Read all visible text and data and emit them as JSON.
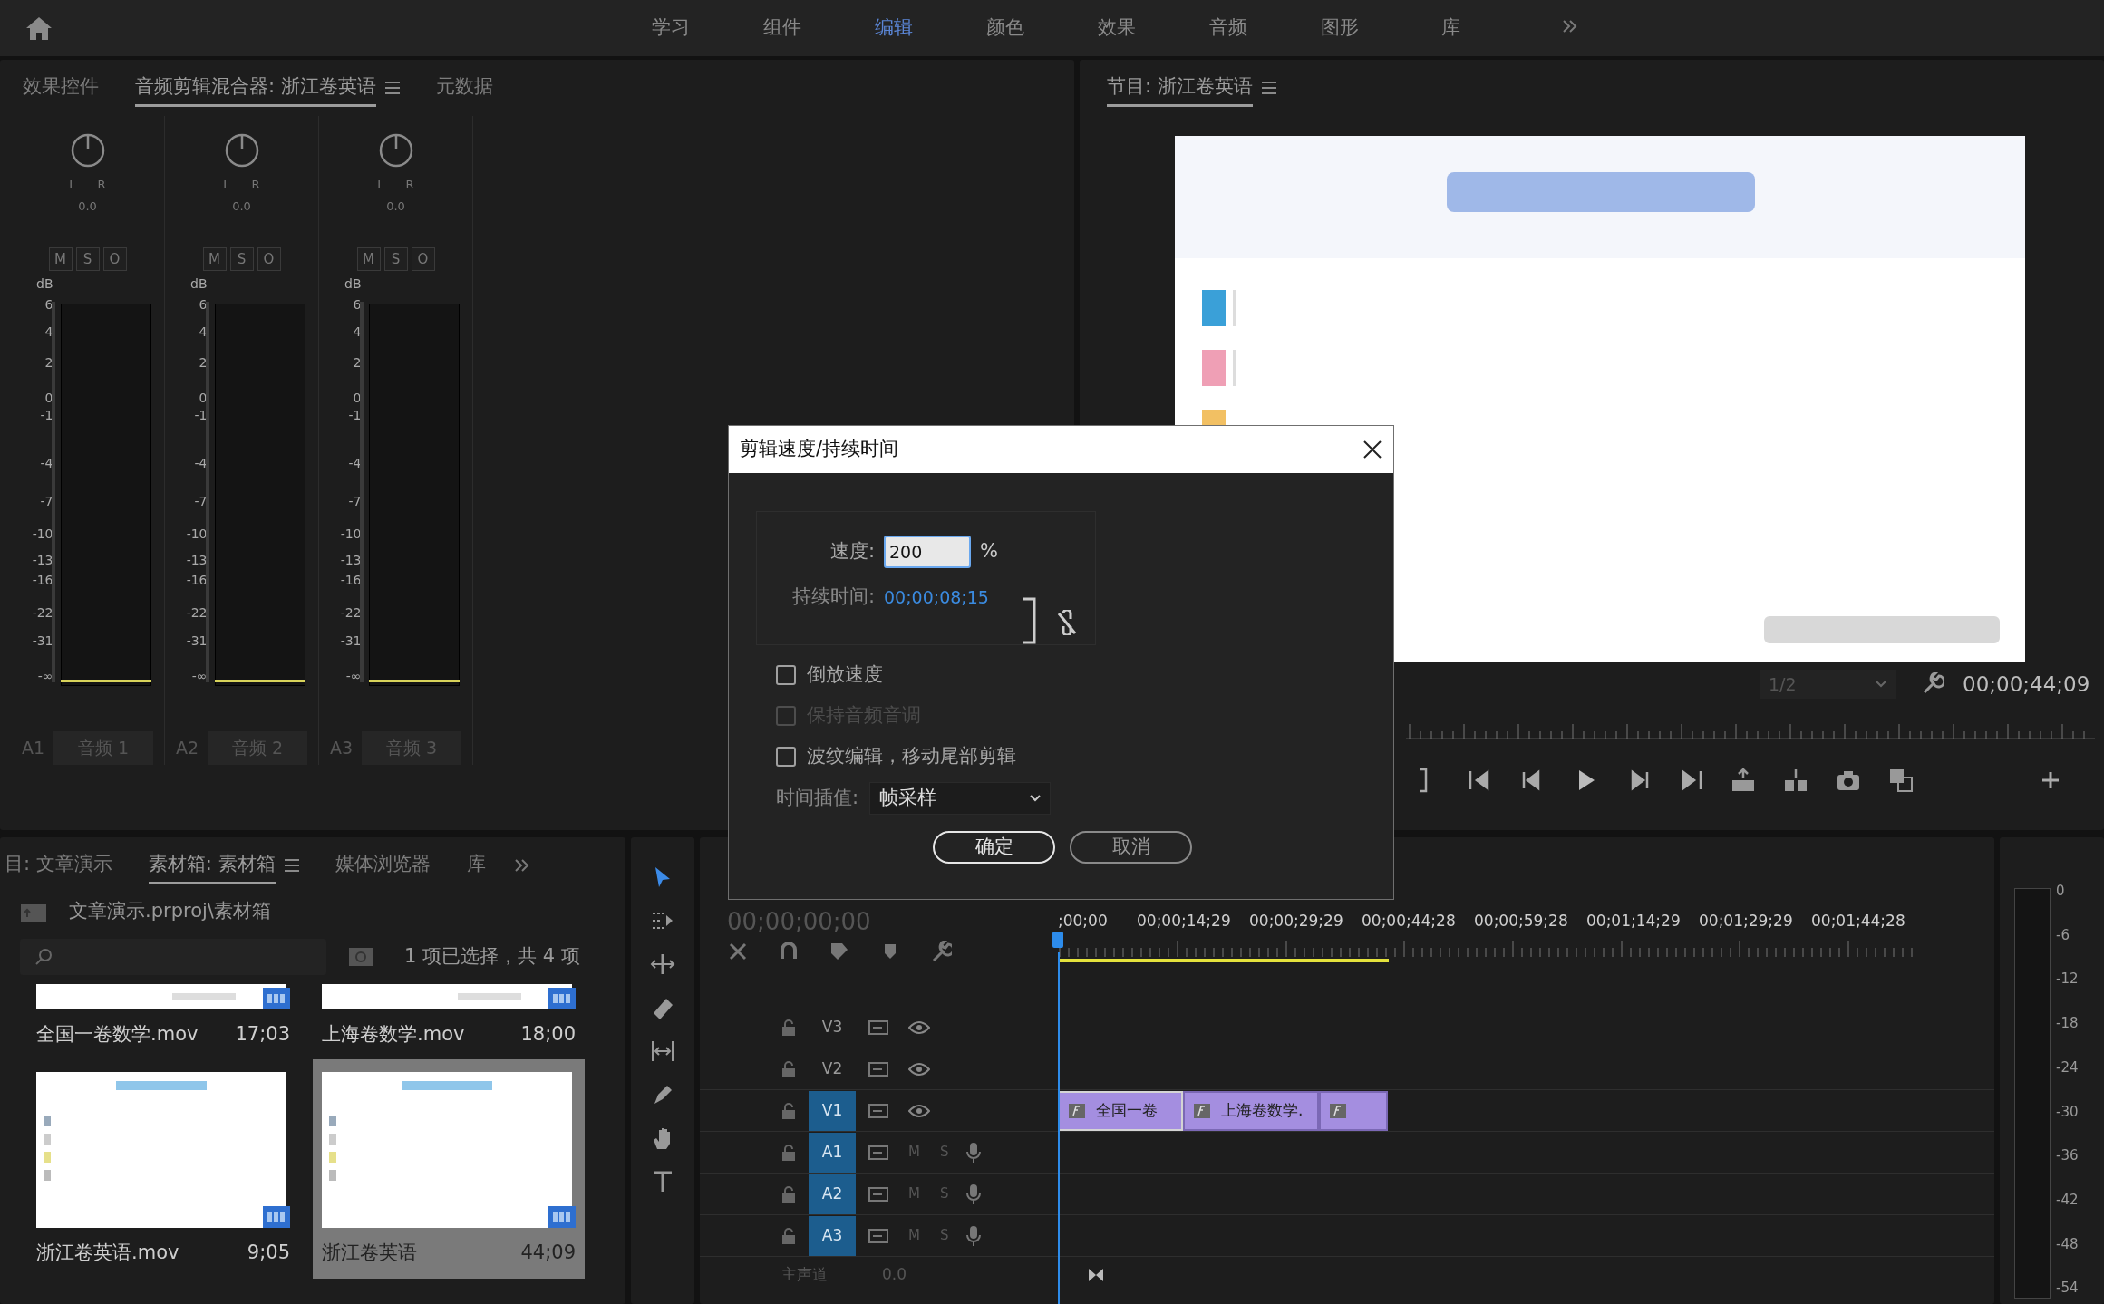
{
  "header": {
    "workspaces": [
      {
        "label": "学习",
        "selected": false
      },
      {
        "label": "组件",
        "selected": false
      },
      {
        "label": "编辑",
        "selected": true
      },
      {
        "label": "颜色",
        "selected": false
      },
      {
        "label": "效果",
        "selected": false
      },
      {
        "label": "音频",
        "selected": false
      },
      {
        "label": "图形",
        "selected": false
      },
      {
        "label": "库",
        "selected": false
      }
    ]
  },
  "mixer_panel": {
    "tabs": [
      {
        "label": "效果控件",
        "selected": false
      },
      {
        "label": "音频剪辑混合器: 浙江卷英语",
        "selected": true
      },
      {
        "label": "元数据",
        "selected": false
      }
    ],
    "channels": [
      {
        "pan_left": "L",
        "pan_right": "R",
        "pan_value": "0.0",
        "buttons": [
          "M",
          "S",
          "O"
        ],
        "unit": "dB",
        "scale": [
          "6",
          "4",
          "2",
          "0",
          "-1",
          "-4",
          "-7",
          "-10",
          "-13",
          "-16",
          "-22",
          "-31",
          "-∞"
        ],
        "track": "A1",
        "name": "音频 1"
      },
      {
        "pan_left": "L",
        "pan_right": "R",
        "pan_value": "0.0",
        "buttons": [
          "M",
          "S",
          "O"
        ],
        "unit": "dB",
        "scale": [
          "6",
          "4",
          "2",
          "0",
          "-1",
          "-4",
          "-7",
          "-10",
          "-13",
          "-16",
          "-22",
          "-31",
          "-∞"
        ],
        "track": "A2",
        "name": "音频 2"
      },
      {
        "pan_left": "L",
        "pan_right": "R",
        "pan_value": "0.0",
        "buttons": [
          "M",
          "S",
          "O"
        ],
        "unit": "dB",
        "scale": [
          "6",
          "4",
          "2",
          "0",
          "-1",
          "-4",
          "-7",
          "-10",
          "-13",
          "-16",
          "-22",
          "-31",
          "-∞"
        ],
        "track": "A3",
        "name": "音频 3"
      }
    ]
  },
  "program_monitor": {
    "tab": {
      "label": "节目: 浙江卷英语",
      "selected": true
    },
    "zoom": "1/2",
    "timecode": "00;00;44;09"
  },
  "project_panel": {
    "tabs": [
      {
        "label": "目: 文章演示",
        "selected": false
      },
      {
        "label": "素材箱: 素材箱",
        "selected": true
      },
      {
        "label": "媒体浏览器",
        "selected": false
      },
      {
        "label": "库",
        "selected": false
      }
    ],
    "path": "文章演示.prproj\\素材箱",
    "selection_count": "1 项已选择，共 4 项",
    "items": [
      {
        "name": "全国一卷数学.mov",
        "duration": "17;03",
        "selected": false
      },
      {
        "name": "上海卷数学.mov",
        "duration": "18;00",
        "selected": false
      },
      {
        "name": "浙江卷英语.mov",
        "duration": "9;05",
        "selected": false
      },
      {
        "name": "浙江卷英语",
        "duration": "44;09",
        "selected": true
      }
    ]
  },
  "timeline": {
    "timecode": "00;00;00;00",
    "ruler": [
      ";00;00",
      "00;00;14;29",
      "00;00;29;29",
      "00;00;44;28",
      "00;00;59;28",
      "00;01;14;29",
      "00;01;29;29",
      "00;01;44;28"
    ],
    "tracks": [
      {
        "label": "V3",
        "kind": "video",
        "targeted": false
      },
      {
        "label": "V2",
        "kind": "video",
        "targeted": false
      },
      {
        "label": "V1",
        "kind": "video",
        "targeted": true
      },
      {
        "label": "A1",
        "kind": "audio",
        "targeted": true,
        "mute": "M",
        "solo": "S"
      },
      {
        "label": "A2",
        "kind": "audio",
        "targeted": true,
        "mute": "M",
        "solo": "S"
      },
      {
        "label": "A3",
        "kind": "audio",
        "targeted": true,
        "mute": "M",
        "solo": "S"
      }
    ],
    "master": {
      "label": "主声道",
      "value": "0.0"
    },
    "clips": [
      {
        "label": "全国一卷",
        "selected": true
      },
      {
        "label": "上海卷数学.",
        "selected": false
      },
      {
        "selected": false
      }
    ]
  },
  "master_meter": {
    "scale": [
      "0",
      "-6",
      "-12",
      "-18",
      "-24",
      "-30",
      "-36",
      "-42",
      "-48",
      "-54"
    ]
  },
  "dialog": {
    "title": "剪辑速度/持续时间",
    "speed_label": "速度:",
    "speed_value": "200",
    "speed_unit": "%",
    "duration_label": "持续时间:",
    "duration_value": "00;00;08;15",
    "linked": false,
    "checkboxes": [
      {
        "label": "倒放速度",
        "checked": false,
        "disabled": false
      },
      {
        "label": "保持音频音调",
        "checked": false,
        "disabled": true
      },
      {
        "label": "波纹编辑，移动尾部剪辑",
        "checked": false,
        "disabled": false
      }
    ],
    "interpolation_label": "时间插值:",
    "interpolation_value": "帧采样",
    "ok": "确定",
    "cancel": "取消"
  }
}
